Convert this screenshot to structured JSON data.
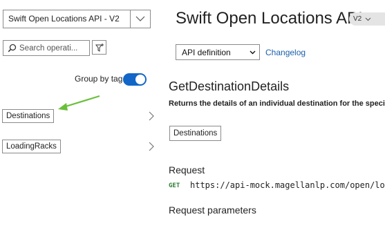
{
  "sidebar": {
    "api_select": {
      "label": "Swift Open Locations API - V2"
    },
    "search": {
      "placeholder": "Search operati..."
    },
    "group_by_tag": {
      "label": "Group by tag",
      "enabled": true
    },
    "tags": [
      {
        "label": "Destinations"
      },
      {
        "label": "LoadingRacks"
      }
    ]
  },
  "main": {
    "api_title": "Swift Open Locations API",
    "version_badge": "V2",
    "definition_select": {
      "label": "API definition"
    },
    "changelog_link": "Changelog",
    "operation": {
      "title": "GetDestinationDetails",
      "description": "Returns the details of an individual destination for the specified d",
      "tag": "Destinations",
      "request_heading": "Request",
      "method": "GET",
      "url": "https://api-mock.magellanlp.com/open/locati",
      "params_heading": "Request parameters"
    }
  },
  "colors": {
    "toggle_on": "#1166c8",
    "link": "#1a5fa8",
    "method_get": "#2e7d32",
    "annotation_arrow": "#6abf3a"
  }
}
